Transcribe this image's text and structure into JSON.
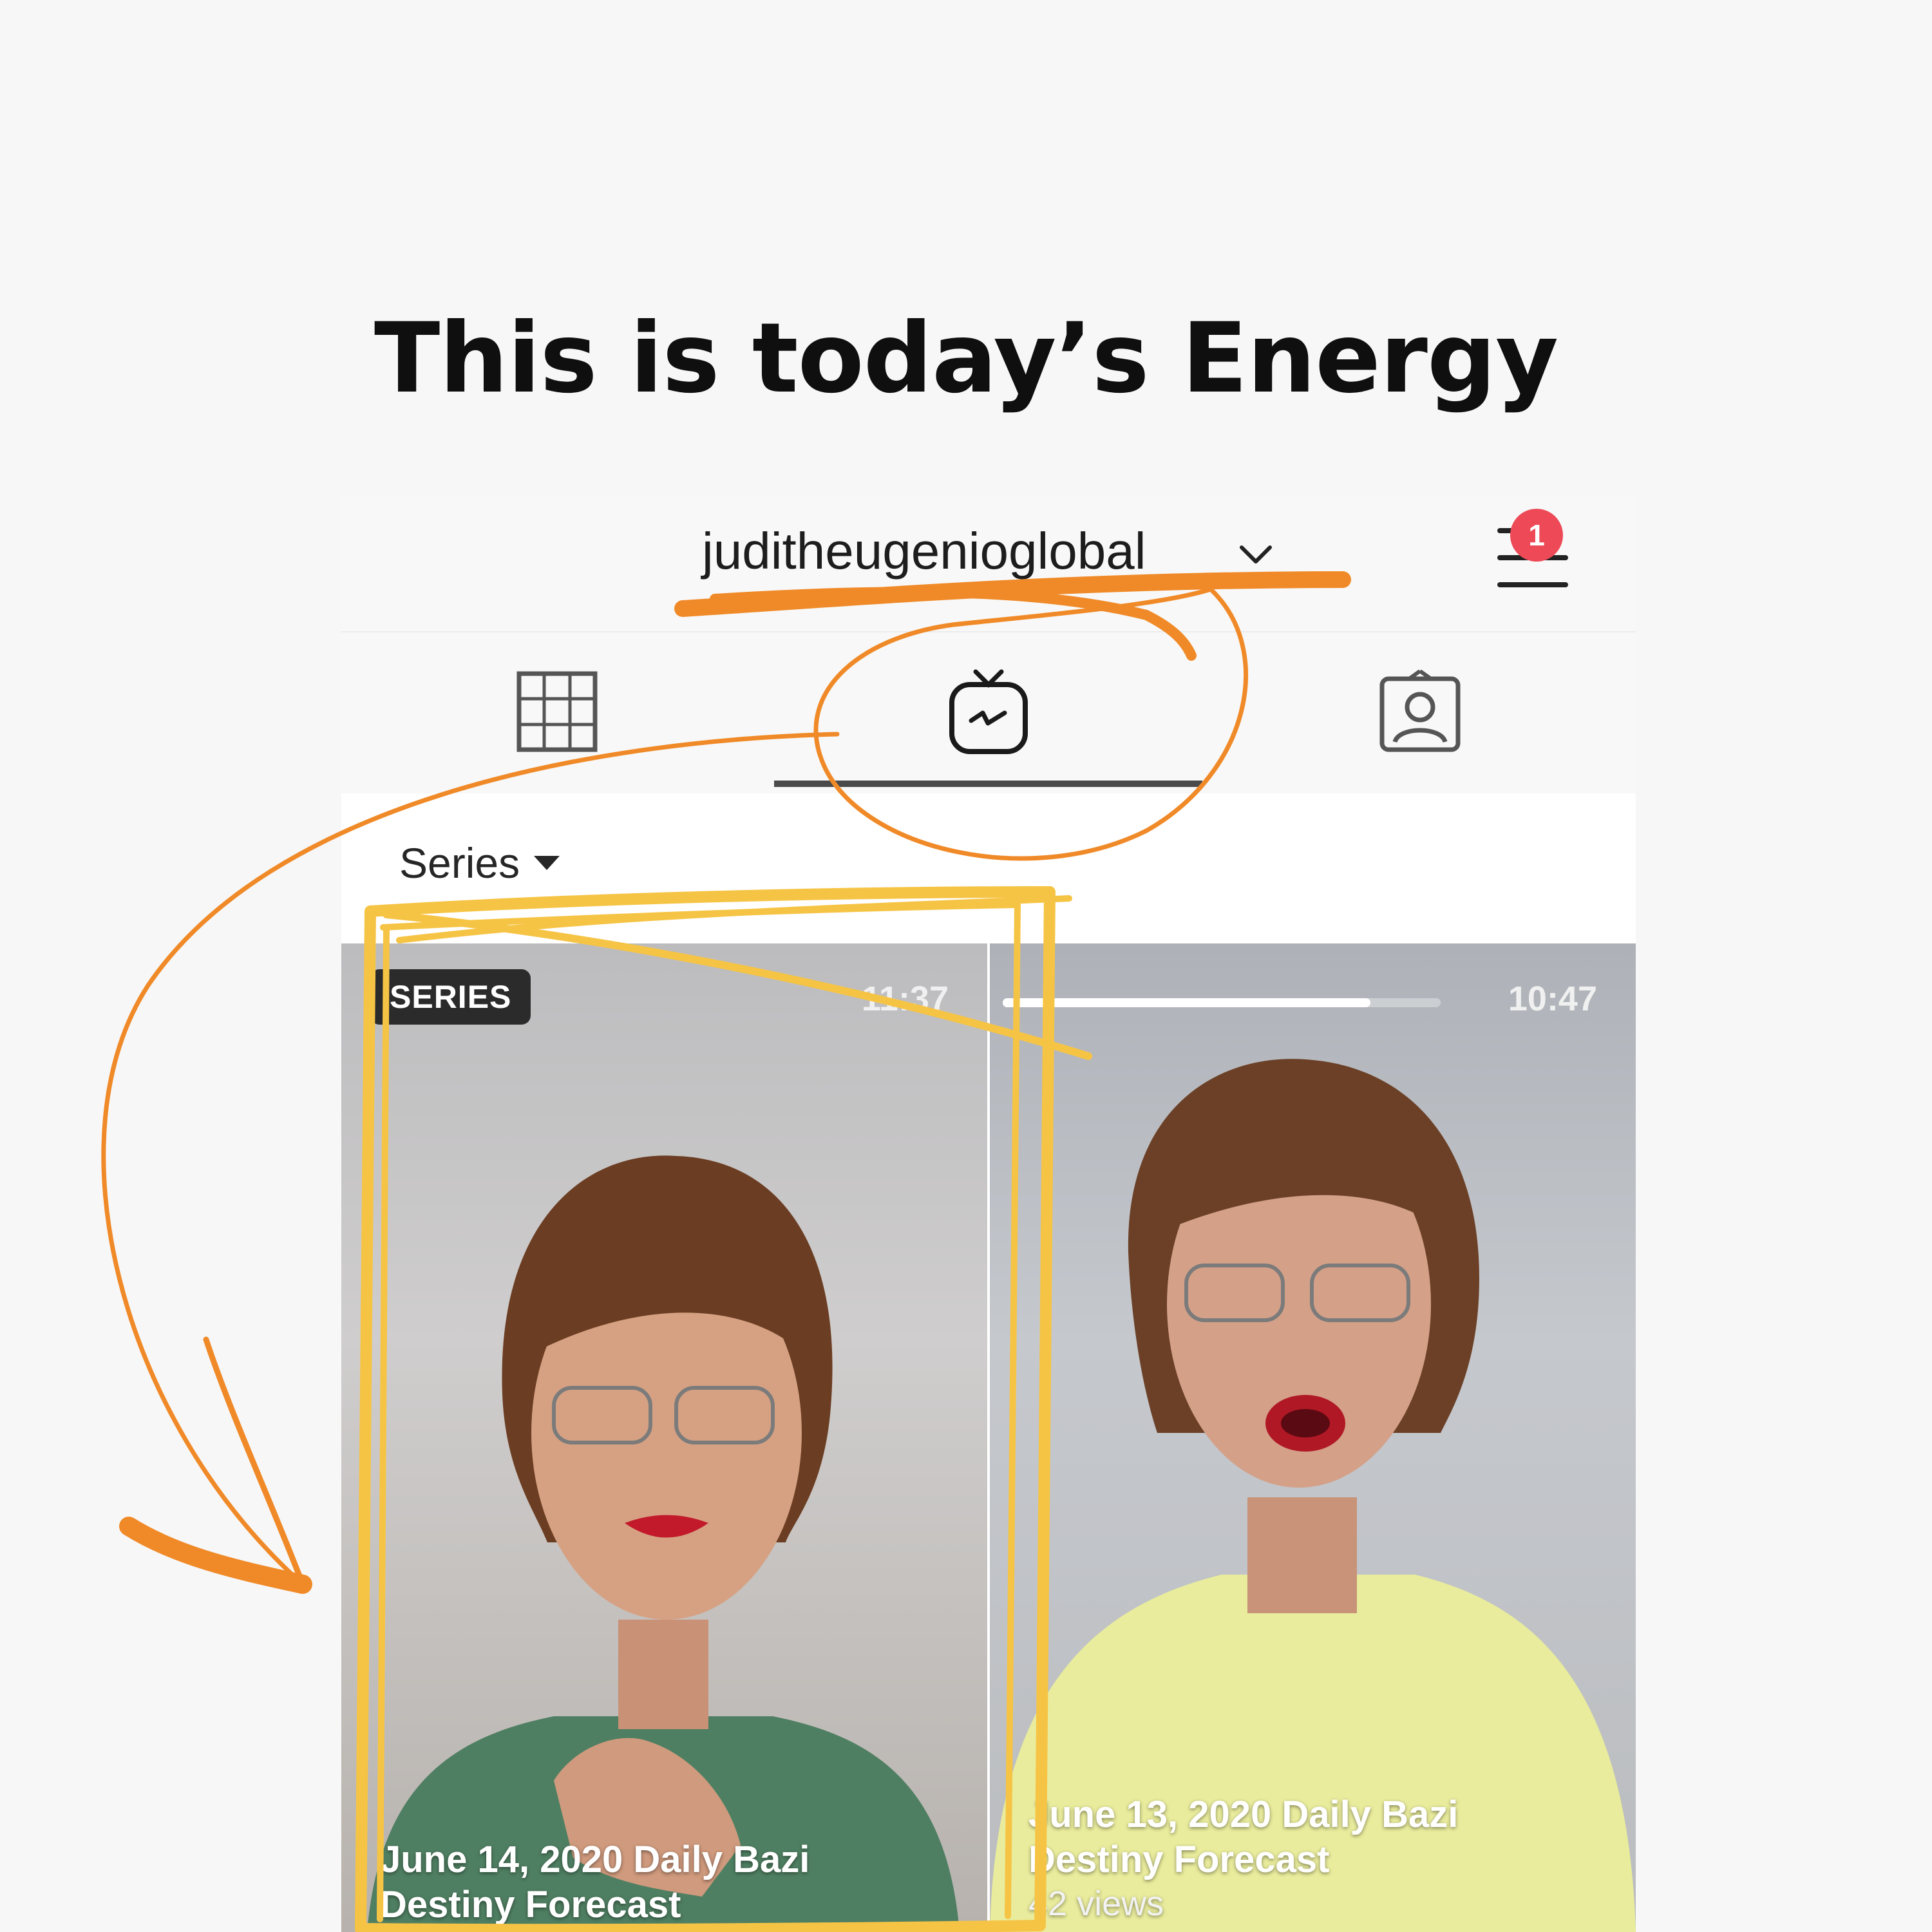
{
  "headline": "This is today’s Energy",
  "profile": {
    "username": "juditheugenioglobal",
    "notification_count": "1"
  },
  "tabs": [
    {
      "icon": "grid-icon",
      "selected": false
    },
    {
      "icon": "igtv-icon",
      "selected": true
    },
    {
      "icon": "tagged-icon",
      "selected": false
    }
  ],
  "filter": {
    "label": "Series"
  },
  "videos": [
    {
      "badge": "SERIES",
      "duration": "11:37",
      "title_line1": "June 14, 2020 Daily Bazi",
      "title_line2": "Destiny Forecast"
    },
    {
      "duration": "10:47",
      "progress_fraction": 0.84,
      "title_line1": "June 13, 2020 Daily Bazi",
      "title_line2": "Destiny Forecast",
      "views": "42 views"
    }
  ],
  "colors": {
    "badge": "#ed4956",
    "annotation_orange": "#f08a28",
    "annotation_yellow": "#f6c445"
  }
}
